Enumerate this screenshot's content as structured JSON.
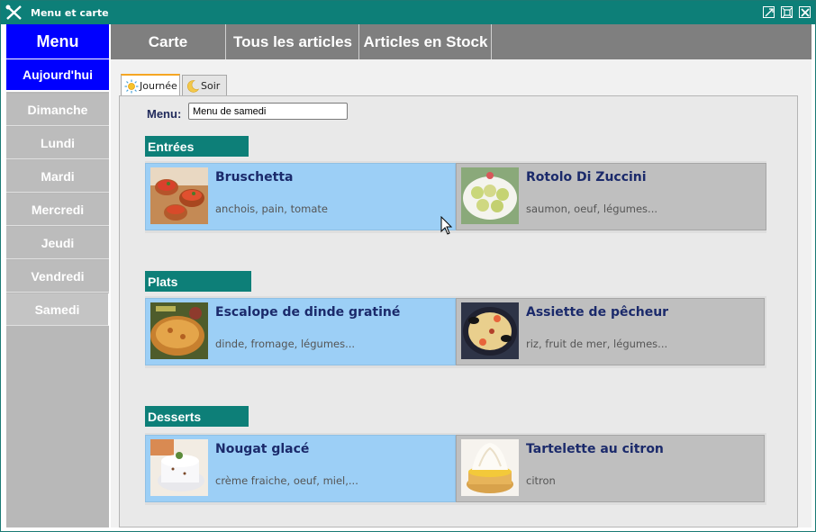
{
  "window": {
    "title": "Menu et carte"
  },
  "header": {
    "menu_label": "Menu"
  },
  "topnav": {
    "tabs": [
      {
        "label": "Carte"
      },
      {
        "label": "Tous les articles"
      },
      {
        "label": "Articles en Stock"
      }
    ]
  },
  "sidebar": {
    "days": [
      {
        "label": "Aujourd'hui"
      },
      {
        "label": "Dimanche"
      },
      {
        "label": "Lundi"
      },
      {
        "label": "Mardi"
      },
      {
        "label": "Mercredi"
      },
      {
        "label": "Jeudi"
      },
      {
        "label": "Vendredi"
      },
      {
        "label": "Samedi"
      }
    ]
  },
  "subtabs": [
    {
      "label": "Journée",
      "icon": "sun-icon"
    },
    {
      "label": "Soir",
      "icon": "moon-icon"
    }
  ],
  "menu_field": {
    "label": "Menu:",
    "value": "Menu de samedi"
  },
  "sections": [
    {
      "title": "Entrées",
      "items": [
        {
          "name": "Bruschetta",
          "description": "anchois, pain, tomate"
        },
        {
          "name": "Rotolo Di Zuccini",
          "description": "saumon, oeuf, légumes..."
        }
      ]
    },
    {
      "title": "Plats",
      "items": [
        {
          "name": "Escalope de dinde gratiné",
          "description": "dinde, fromage, légumes..."
        },
        {
          "name": "Assiette de pêcheur",
          "description": "riz, fruit de mer, légumes..."
        }
      ]
    },
    {
      "title": "Desserts",
      "items": [
        {
          "name": "Nougat glacé",
          "description": "crème fraiche, oeuf, miel,..."
        },
        {
          "name": "Tartelette au citron",
          "description": "citron"
        }
      ]
    }
  ],
  "colors": {
    "titlebar": "#0d7f78",
    "menu_header": "#0000ff",
    "active_day": "#0000ff",
    "section_title": "#0d7f78",
    "card_highlight": "#9ccff6",
    "card_default": "#bfbfbf"
  }
}
